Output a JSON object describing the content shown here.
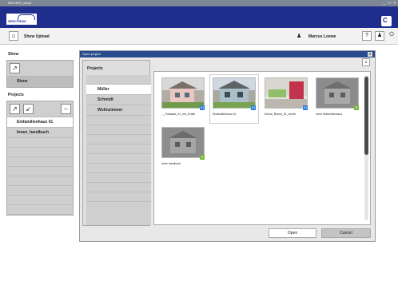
{
  "window": {
    "title": "MS FAST_cloud",
    "controls": "_ □ ×"
  },
  "brand": {
    "logo_text": "SPECTRUM",
    "right_logo": "C"
  },
  "toolbar": {
    "title": "Show Upload",
    "user_name": "Marcus Loewe",
    "help_label": "?",
    "user_btn_label": "♟",
    "power_label": "⏻",
    "home_label": "⌂"
  },
  "sidebar": {
    "show_header": "Show",
    "show_item": "Show",
    "projects_header": "Projects",
    "project_items": [
      {
        "label": "Einfamilienhaus 01",
        "selected": true
      },
      {
        "label": "Innen_handbuch",
        "selected": false
      }
    ]
  },
  "dialog": {
    "title": "Open project",
    "close_label": "x",
    "projects_header": "Projects",
    "project_list": [
      {
        "label": "Müller",
        "selected": true
      },
      {
        "label": "Schmidt",
        "selected": false
      },
      {
        "label": "Wohnzimmer",
        "selected": false
      }
    ],
    "thumbnails": [
      {
        "caption": "..._Fassade_01_mit_Grafik",
        "badge": "01",
        "badge_color": "#2a7fd4"
      },
      {
        "caption": "Einfamilienhaus 01",
        "badge": "01",
        "badge_color": "#2a7fd4",
        "selected": true
      },
      {
        "caption": "Küche_Brown_01_vorher",
        "badge": "01",
        "badge_color": "#2a7fd4"
      },
      {
        "caption": "ohne einfamilienhaus",
        "badge": "G",
        "badge_color": "#7ab43a"
      },
      {
        "caption": "ohne handbuch",
        "badge": "G",
        "badge_color": "#7ab43a"
      }
    ],
    "open_label": "Open",
    "cancel_label": "Cancel"
  }
}
